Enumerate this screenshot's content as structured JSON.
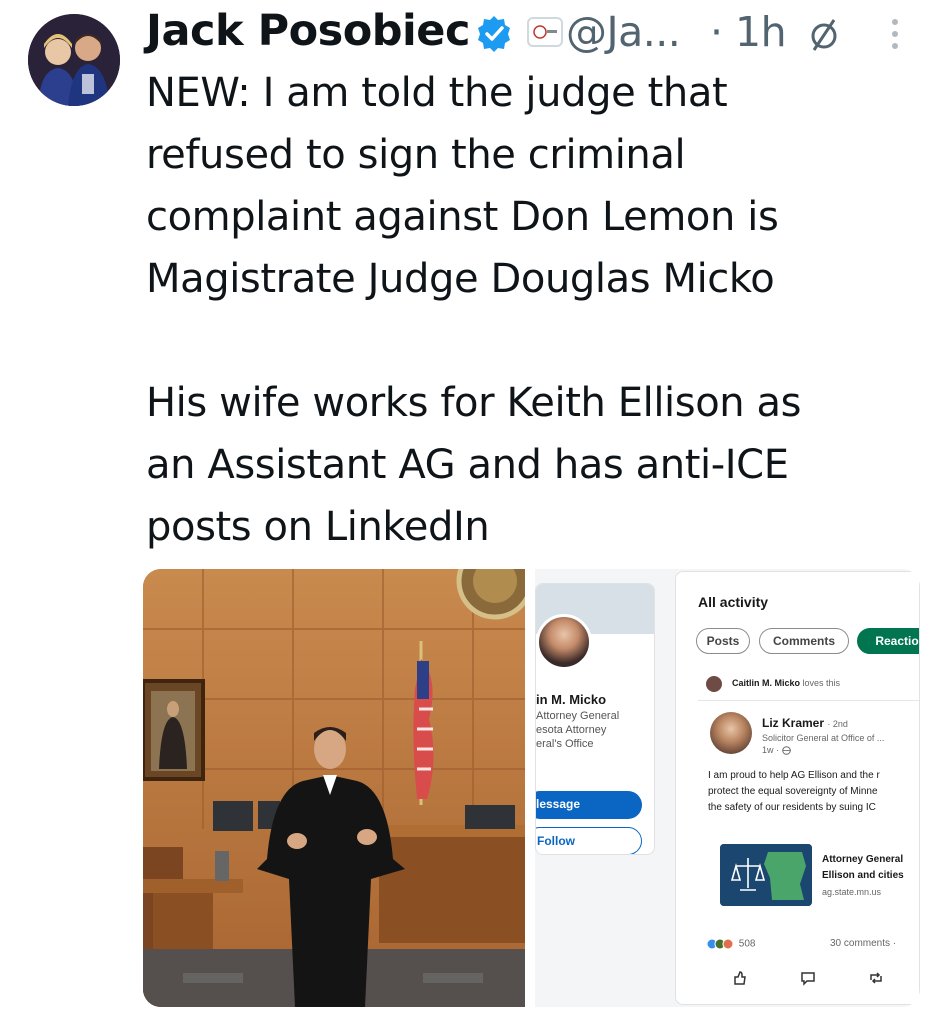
{
  "tweet": {
    "author_name": "Jack Posobiec",
    "handle": "@Ja...",
    "separator": "·",
    "time": "1h",
    "paragraphs": [
      "NEW: I am told the judge that\nrefused to sign the criminal\ncomplaint against Don Lemon is\nMagistrate Judge Douglas Micko",
      "His wife works for Keith Ellison as\nan Assistant AG and has anti-ICE\nposts on LinkedIn"
    ]
  },
  "linkedin": {
    "profile": {
      "name": "in M. Micko",
      "line1": "Attorney General",
      "line2": "esota Attorney",
      "line3": "eral's Office",
      "message_label": "lessage",
      "follow_label": "Follow"
    },
    "activity": {
      "title": "All activity",
      "pills": [
        "Posts",
        "Comments",
        "Reactio"
      ],
      "loves_name": "Caitlin M. Micko",
      "loves_text": "loves this",
      "poster_name": "Liz Kramer",
      "poster_degree": "· 2nd",
      "poster_role": "Solicitor General at Office of ...",
      "poster_time": "1w ·",
      "post_lines": [
        "I am proud to help AG Ellison and the r",
        "protect the equal sovereignty of Minne",
        "the safety of our residents by suing IC"
      ],
      "link_title_1": "Attorney General",
      "link_title_2": "Ellison and cities",
      "link_url": "ag.state.mn.us",
      "reaction_count": "508",
      "comments": "30 comments ·"
    }
  },
  "colors": {
    "verified": "#1d9bf0",
    "muted_text": "#536471",
    "linkedin_blue": "#0a66c2",
    "linkedin_green": "#01754f"
  }
}
